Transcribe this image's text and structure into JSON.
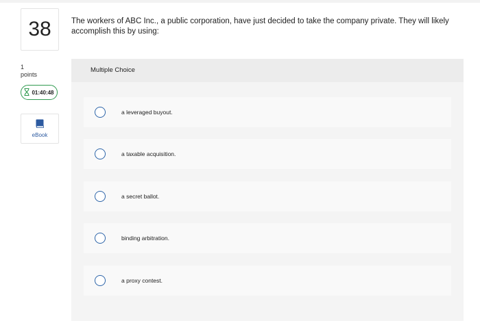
{
  "question": {
    "number": "38",
    "text": "The workers of ABC Inc., a public corporation, have just decided to take the company private. They will likely accomplish this by using:",
    "points_value": "1",
    "points_label": "points"
  },
  "timer": {
    "value": "01:40:48",
    "icon": "hourglass-icon",
    "color": "#2f9a4f"
  },
  "ebook": {
    "label": "eBook",
    "icon": "book-icon",
    "color": "#2c5aa0"
  },
  "choices": {
    "title": "Multiple Choice",
    "options": [
      {
        "label": "a leveraged buyout."
      },
      {
        "label": "a taxable acquisition."
      },
      {
        "label": "a secret ballot."
      },
      {
        "label": "binding arbitration."
      },
      {
        "label": "a proxy contest."
      }
    ],
    "radio_color": "#2c64a8"
  }
}
